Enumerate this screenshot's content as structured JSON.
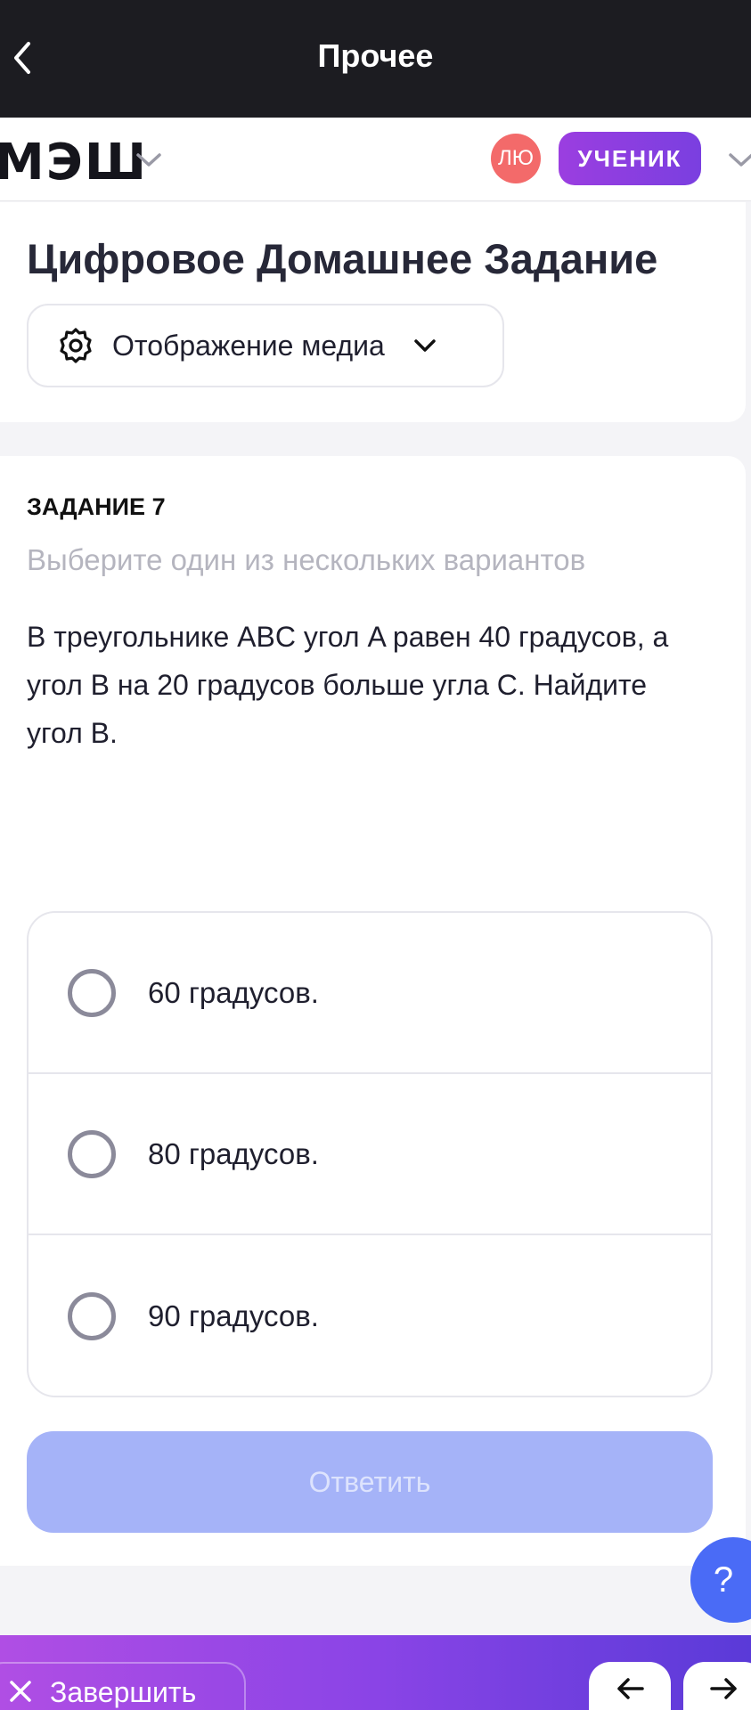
{
  "topbar": {
    "title": "Прочее"
  },
  "header": {
    "logo": "МЭШ",
    "avatar_initials": "ЛЮ",
    "role_badge": "УЧЕНИК"
  },
  "intro": {
    "title": "Цифровое Домашнее Задание",
    "media_button": "Отображение медиа"
  },
  "task": {
    "number": "ЗАДАНИЕ 7",
    "hint": "Выберите один из нескольких вариантов",
    "question": "В треугольнике ABC угол A равен 40 градусов, а угол B на 20 градусов больше угла C. Найдите угол B.",
    "options": [
      {
        "label": "60 градусов."
      },
      {
        "label": "80 градусов."
      },
      {
        "label": "90 градусов."
      }
    ],
    "submit": "Ответить"
  },
  "help": {
    "label": "?"
  },
  "bottombar": {
    "finish": "Завершить"
  }
}
